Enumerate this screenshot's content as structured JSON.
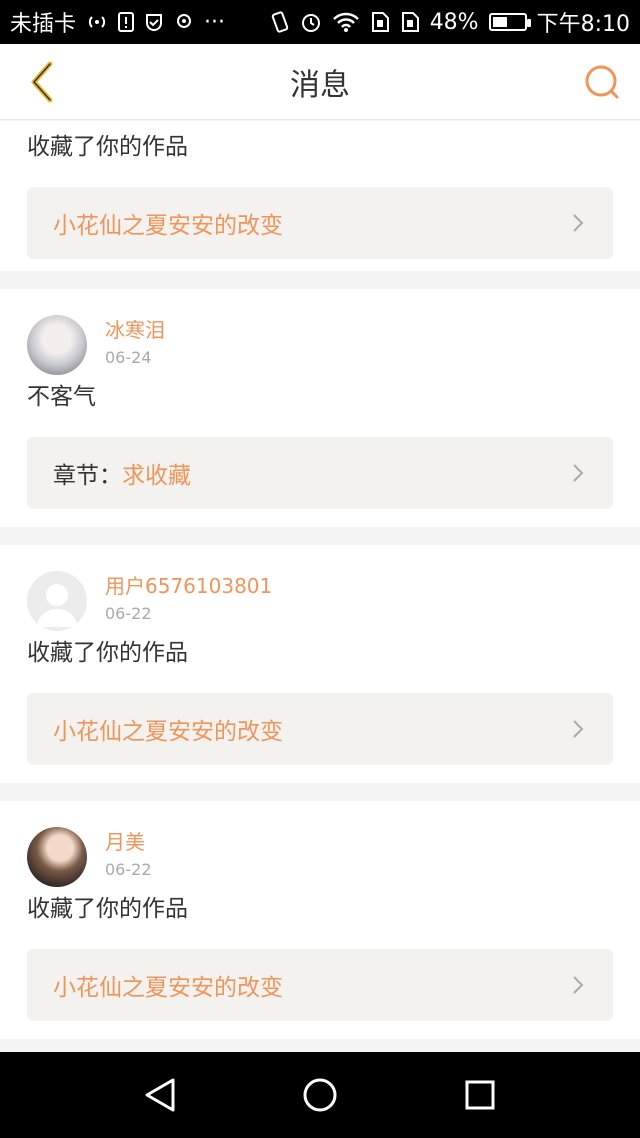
{
  "status_bar": {
    "carrier": "未插卡",
    "battery_text": "48%",
    "battery_level": 0.48,
    "time": "下午8:10",
    "more": "···"
  },
  "header": {
    "title": "消息"
  },
  "messages": [
    {
      "text": "收藏了你的作品",
      "link_title": "小花仙之夏安安的改变"
    },
    {
      "user_name": "冰寒泪",
      "date": "06-24",
      "text": "不客气",
      "link_prefix": "章节：",
      "link_title": "求收藏"
    },
    {
      "user_name": "用户6576103801",
      "date": "06-22",
      "text": "收藏了你的作品",
      "link_title": "小花仙之夏安安的改变"
    },
    {
      "user_name": "月美",
      "date": "06-22",
      "text": "收藏了你的作品",
      "link_title": "小花仙之夏安安的改变"
    }
  ],
  "colors": {
    "accent": "#f0955a",
    "link_bg": "#f3f2ee",
    "back_arrow": "#e8b830"
  }
}
